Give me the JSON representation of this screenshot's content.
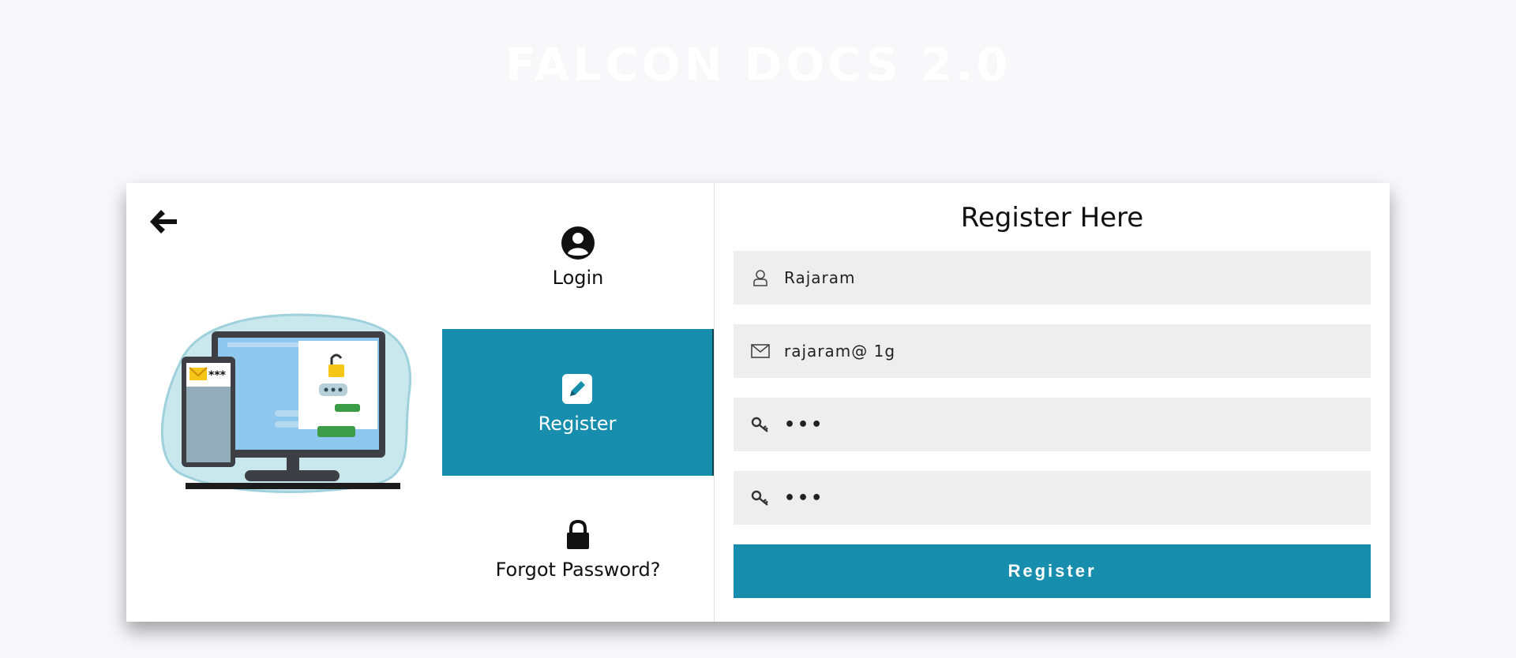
{
  "app_title": "FALCON DOCS 2.0",
  "nav": {
    "login_label": "Login",
    "register_label": "Register",
    "forgot_label": "Forgot Password?"
  },
  "illustration": {
    "password_mask": "***"
  },
  "form": {
    "title": "Register Here",
    "username_value": "Rajaram",
    "email_value": "rajaram@ 1g",
    "password_value": "•••",
    "confirm_password_value": "•••",
    "submit_label": "Register"
  },
  "colors": {
    "accent": "#178eae",
    "field_bg": "#eeeeee",
    "page_bg": "#f8f8fa"
  }
}
